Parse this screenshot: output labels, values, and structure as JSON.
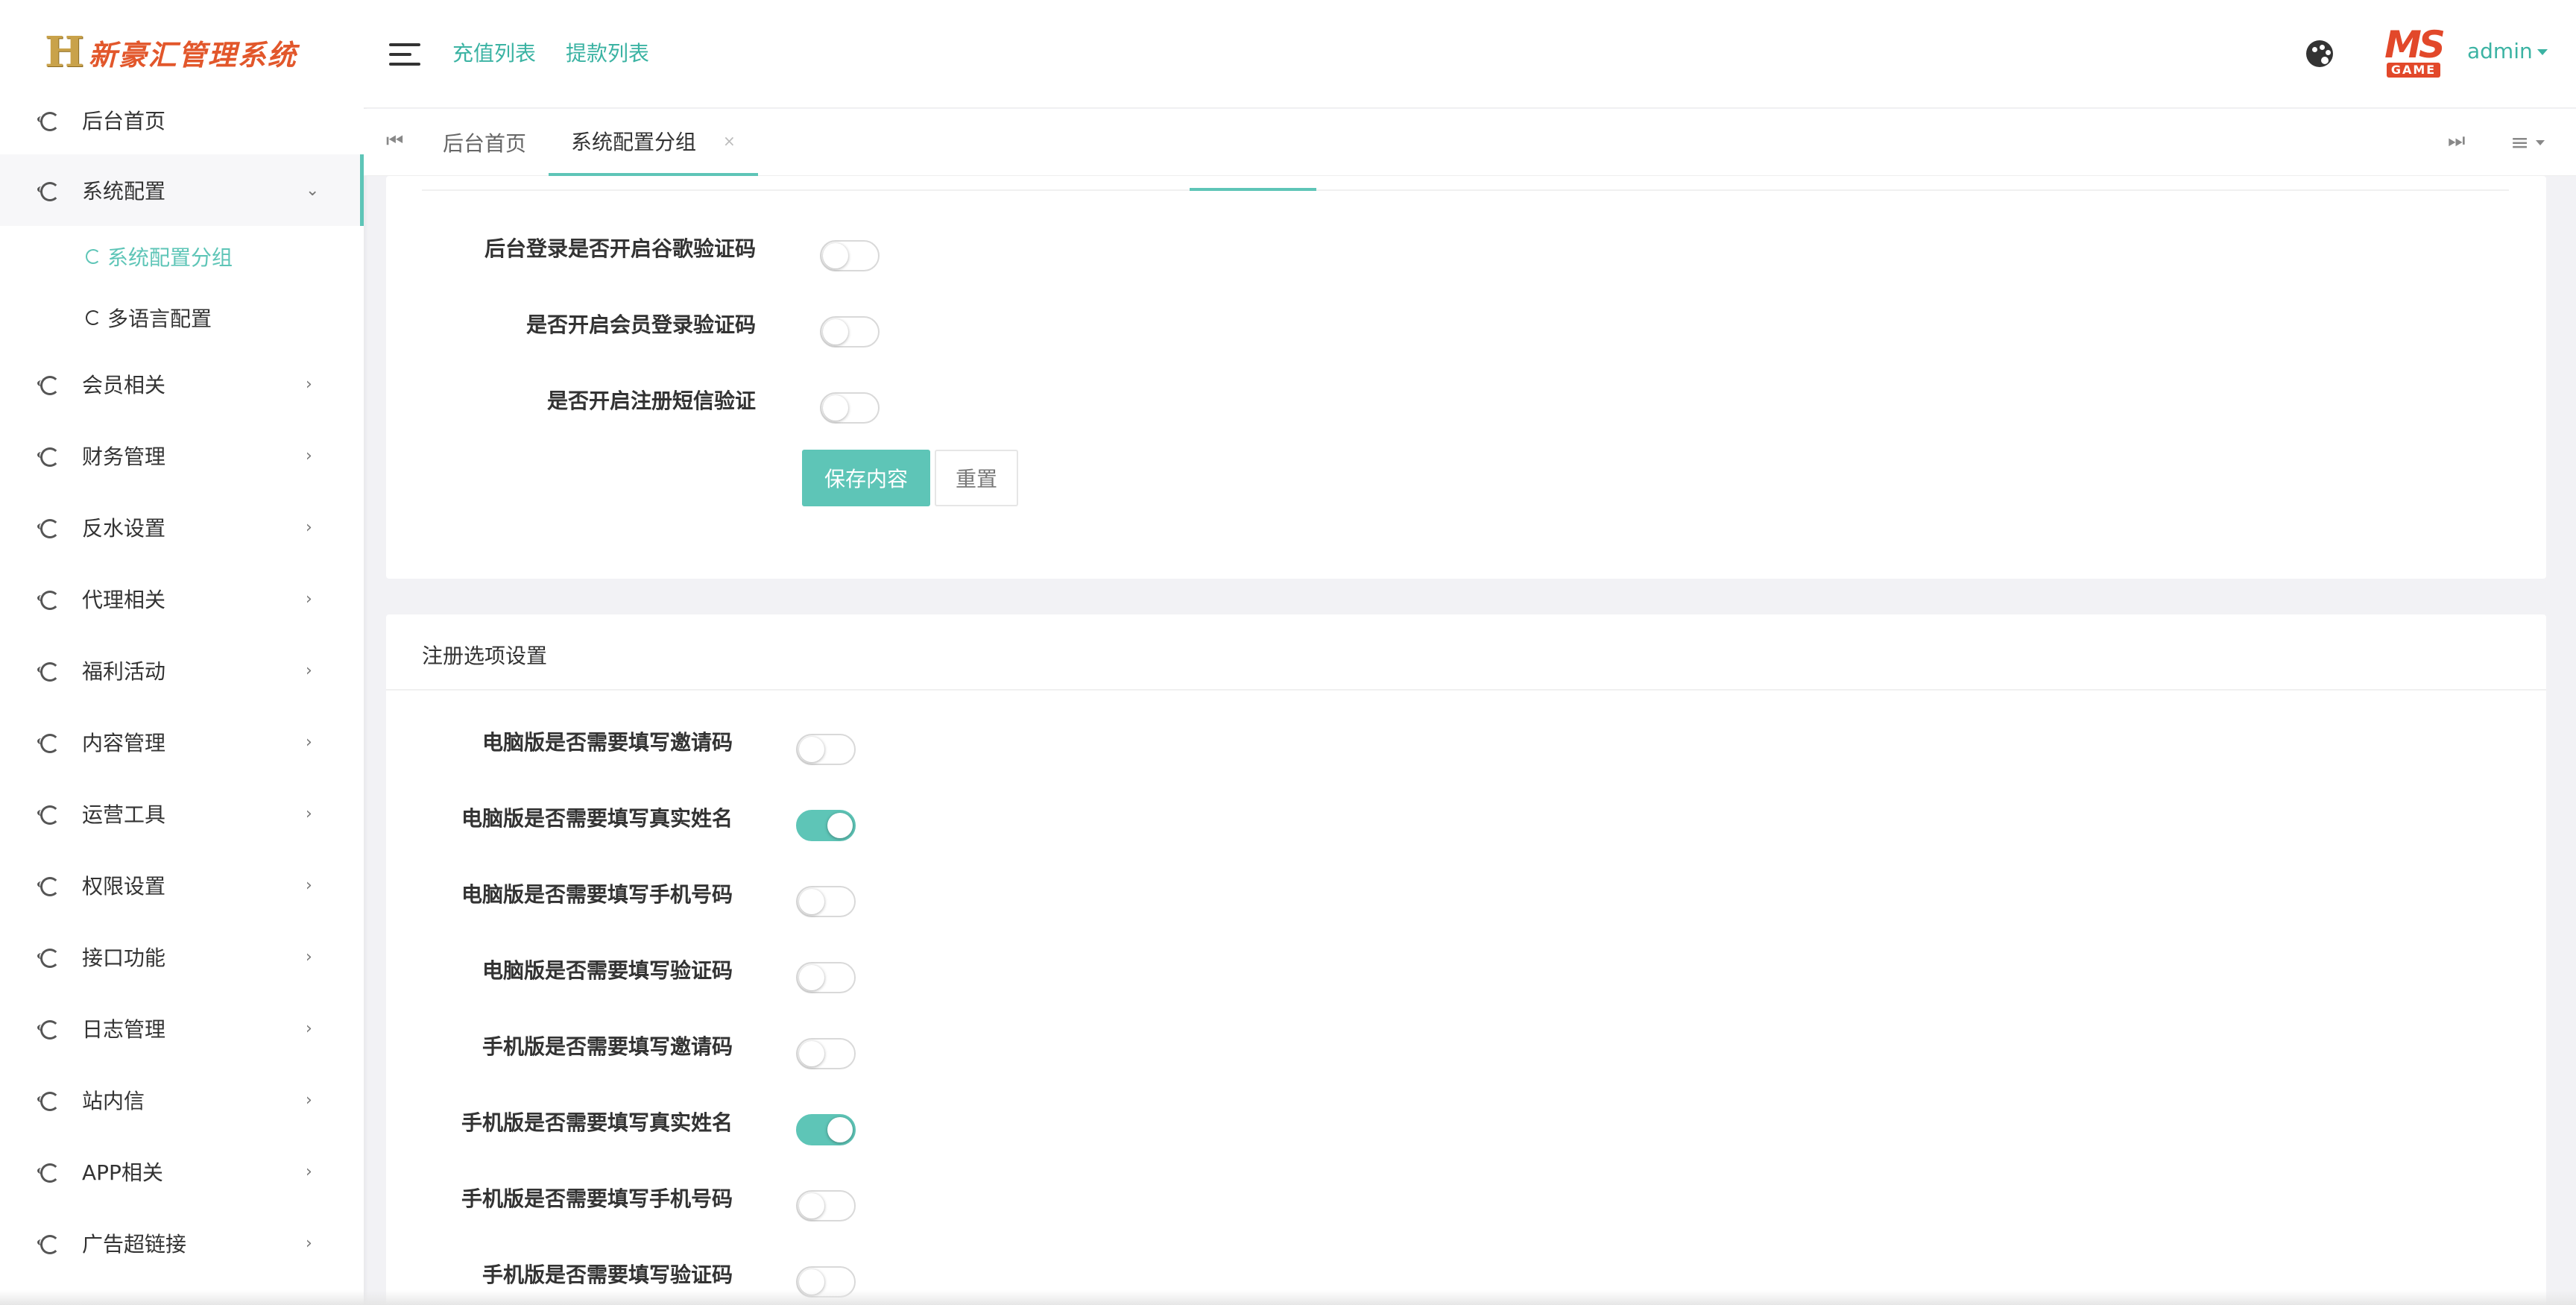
{
  "logo": {
    "mark": "H",
    "text": "新豪汇管理系统"
  },
  "sidebar": {
    "items": [
      {
        "label": "后台首页"
      },
      {
        "label": "系统配置",
        "expanded": true,
        "children": [
          {
            "label": "系统配置分组",
            "active": true
          },
          {
            "label": "多语言配置"
          }
        ]
      },
      {
        "label": "会员相关"
      },
      {
        "label": "财务管理"
      },
      {
        "label": "反水设置"
      },
      {
        "label": "代理相关"
      },
      {
        "label": "福利活动"
      },
      {
        "label": "内容管理"
      },
      {
        "label": "运营工具"
      },
      {
        "label": "权限设置"
      },
      {
        "label": "接口功能"
      },
      {
        "label": "日志管理"
      },
      {
        "label": "站内信"
      },
      {
        "label": "APP相关"
      },
      {
        "label": "广告超链接"
      }
    ]
  },
  "header": {
    "links": [
      "充值列表",
      "提款列表"
    ],
    "avatar": {
      "top": "MS",
      "bottom": "GAME"
    },
    "user": "admin"
  },
  "tabs": [
    {
      "label": "后台首页"
    },
    {
      "label": "系统配置分组",
      "active": true,
      "close": "×"
    }
  ],
  "login_settings": {
    "rows": [
      {
        "label": "后台登录是否开启谷歌验证码",
        "on": false
      },
      {
        "label": "是否开启会员登录验证码",
        "on": false
      },
      {
        "label": "是否开启注册短信验证",
        "on": false
      }
    ],
    "save_label": "保存内容",
    "reset_label": "重置"
  },
  "register_settings": {
    "title": "注册选项设置",
    "rows": [
      {
        "label": "电脑版是否需要填写邀请码",
        "on": false
      },
      {
        "label": "电脑版是否需要填写真实姓名",
        "on": true
      },
      {
        "label": "电脑版是否需要填写手机号码",
        "on": false
      },
      {
        "label": "电脑版是否需要填写验证码",
        "on": false
      },
      {
        "label": "手机版是否需要填写邀请码",
        "on": false
      },
      {
        "label": "手机版是否需要填写真实姓名",
        "on": true
      },
      {
        "label": "手机版是否需要填写手机号码",
        "on": false
      },
      {
        "label": "手机版是否需要填写验证码",
        "on": false
      }
    ]
  },
  "colors": {
    "accent": "#5ec5b7",
    "link": "#3bb3a3",
    "logo": "#e2572b"
  }
}
